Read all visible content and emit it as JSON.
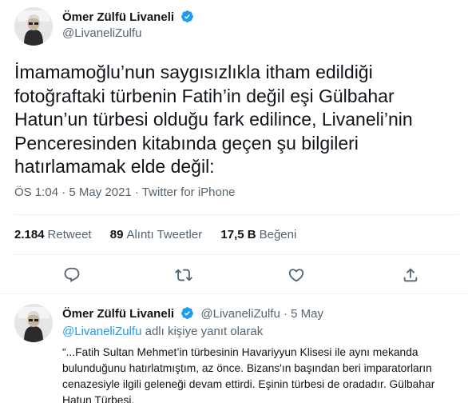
{
  "main_tweet": {
    "author_name": "Ömer Zülfü Livaneli",
    "handle": "@LivaneliZulfu",
    "text": "İmamamoğlu’nun saygısızlıkla itham edildiği fotoğraftaki türbenin Fatih’in değil eşi Gülbahar Hatun’un türbesi olduğu fark edilince, Livaneli’nin Penceresinden kitabında geçen şu bilgileri hatırlamamak elde değil:",
    "timestamp": "ÖS 1:04 · 5 May 2021 · Twitter for iPhone",
    "stats": {
      "retweets_count": "2.184",
      "retweets_label": "Retweet",
      "quotes_count": "89",
      "quotes_label": "Alıntı Tweetler",
      "likes_count": "17,5 B",
      "likes_label": "Beğeni"
    },
    "actions": [
      "reply-icon",
      "retweet-icon",
      "like-icon",
      "share-icon"
    ]
  },
  "reply_tweet": {
    "author_name": "Ömer Zülfü Livaneli",
    "handle_date": "@LivaneliZulfu · 5 May",
    "replying_mention": "@LivaneliZulfu",
    "replying_suffix": " adlı kişiye yanıt olarak",
    "text": "“...Fatih Sultan Mehmet’in türbesinin Havariyyun Klisesi ile aynı mekanda bulunduğunu hatırlatmıştım, az önce. Bizans'ın başından beri imparatorların cenazesiyle ilgili geleneği devam ettirdi. Eşinin türbesi de oradadır. Gülbahar Hatun Türbesi."
  },
  "colors": {
    "accent": "#1d9bf0",
    "text_primary": "#0f1419",
    "text_secondary": "#536471",
    "divider": "#eff3f4"
  }
}
